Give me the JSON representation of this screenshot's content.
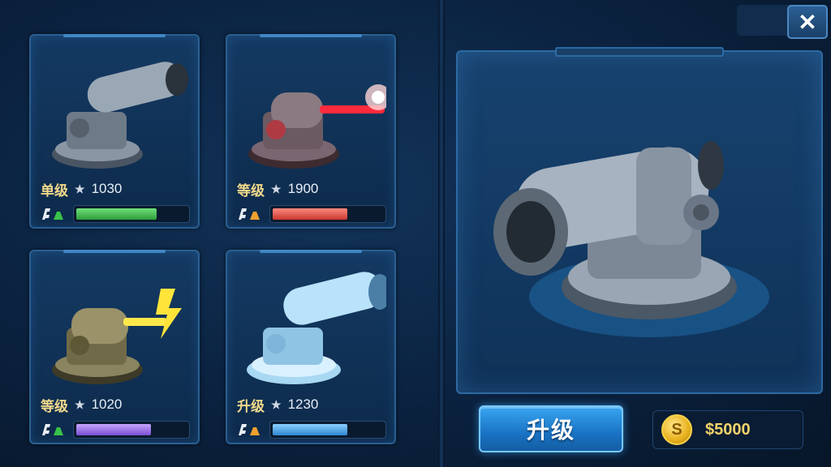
{
  "cards": [
    {
      "label": "单级",
      "rating": "1030",
      "bar_color": "#39c24a",
      "bar_fill": 0.7,
      "icon": "cannon-steel-icon"
    },
    {
      "label": "等级",
      "rating": "1900",
      "bar_color": "#e0574c",
      "bar_fill": 0.65,
      "icon": "laser-cannon-icon"
    },
    {
      "label": "等级",
      "rating": "1020",
      "bar_color": "#9a6ee6",
      "bar_fill": 0.65,
      "icon": "lightning-cannon-icon"
    },
    {
      "label": "升级",
      "rating": "1230",
      "bar_color": "#4aa8f0",
      "bar_fill": 0.65,
      "icon": "ice-cannon-icon"
    }
  ],
  "star_glyph": "★",
  "upgrade_label": "升级",
  "coin_glyph": "S",
  "money": "$5000",
  "close_glyph": "✕"
}
